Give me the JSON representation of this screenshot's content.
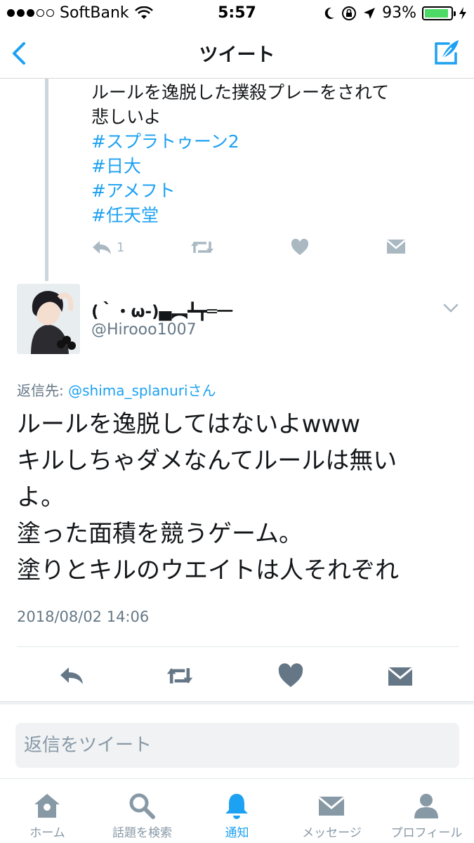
{
  "status_bar": {
    "carrier": "SoftBank",
    "time": "5:57",
    "battery_percent": "93%",
    "battery_level": 0.93,
    "signal_bars": 3,
    "signal_total": 5
  },
  "nav": {
    "title": "ツイート",
    "back_icon": "chevron-left-icon",
    "compose_icon": "compose-icon"
  },
  "previous_tweet": {
    "text_lines": [
      "ルールを逸脱した撲殺プレーをされて",
      "悲しいよ"
    ],
    "hashtags": [
      "#スプラトゥーン2",
      "#日大",
      "#アメフト",
      "#任天堂"
    ],
    "reply_count": "1"
  },
  "tweet": {
    "display_name": "(｀・ω-)▄︻┻┳═一",
    "handle": "@Hirooo1007",
    "reply_prefix": "返信先: ",
    "reply_mention": "@shima_splanuriさん",
    "text_lines": [
      "ルールを逸脱してはないよwww",
      "キルしちゃダメなんてルールは無い",
      "よ。",
      "塗った面積を競うゲーム。",
      "塗りとキルのウエイトは人それぞれ"
    ],
    "timestamp": "2018/08/02 14:06"
  },
  "reply_box": {
    "placeholder": "返信をツイート"
  },
  "tabs": [
    {
      "label": "ホーム",
      "icon": "home-icon",
      "active": false
    },
    {
      "label": "話題を検索",
      "icon": "search-icon",
      "active": false
    },
    {
      "label": "通知",
      "icon": "bell-icon",
      "active": true
    },
    {
      "label": "メッセージ",
      "icon": "envelope-icon",
      "active": false
    },
    {
      "label": "プロフィール",
      "icon": "person-icon",
      "active": false
    }
  ],
  "colors": {
    "accent": "#1da1f2",
    "muted": "#8899a6",
    "action_gray": "#657786",
    "light_action": "#aab8c2"
  }
}
